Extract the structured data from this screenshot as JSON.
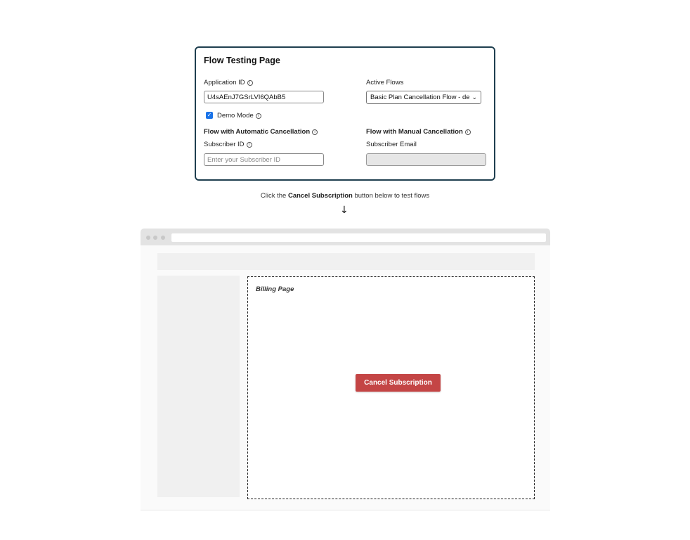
{
  "card": {
    "title": "Flow Testing Page",
    "application_id_label": "Application ID",
    "application_id_value": "U4sAEnJ7GSrLVI6QAbB5",
    "active_flows_label": "Active Flows",
    "active_flows_selected": "Basic Plan Cancellation Flow - default",
    "demo_mode_label": "Demo Mode",
    "demo_mode_checked": true,
    "auto_cancel_label": "Flow with Automatic Cancellation",
    "manual_cancel_label": "Flow with Manual Cancellation",
    "subscriber_id_label": "Subscriber ID",
    "subscriber_id_placeholder": "Enter your Subscriber ID",
    "subscriber_email_label": "Subscriber Email",
    "subscriber_email_value": ""
  },
  "hint": {
    "prefix": "Click the ",
    "emphasis": "Cancel Subscription",
    "suffix": " button below to test flows"
  },
  "icons": {
    "info": "info-icon",
    "arrow": "arrow-down-icon",
    "check": "checkmark-icon",
    "chevron": "chevron-down-icon"
  },
  "billing": {
    "title": "Billing Page",
    "cancel_button_label": "Cancel Subscription"
  },
  "colors": {
    "card_border": "#1f3f4f",
    "cancel_button": "#c44545",
    "checkbox": "#1a73e8"
  }
}
